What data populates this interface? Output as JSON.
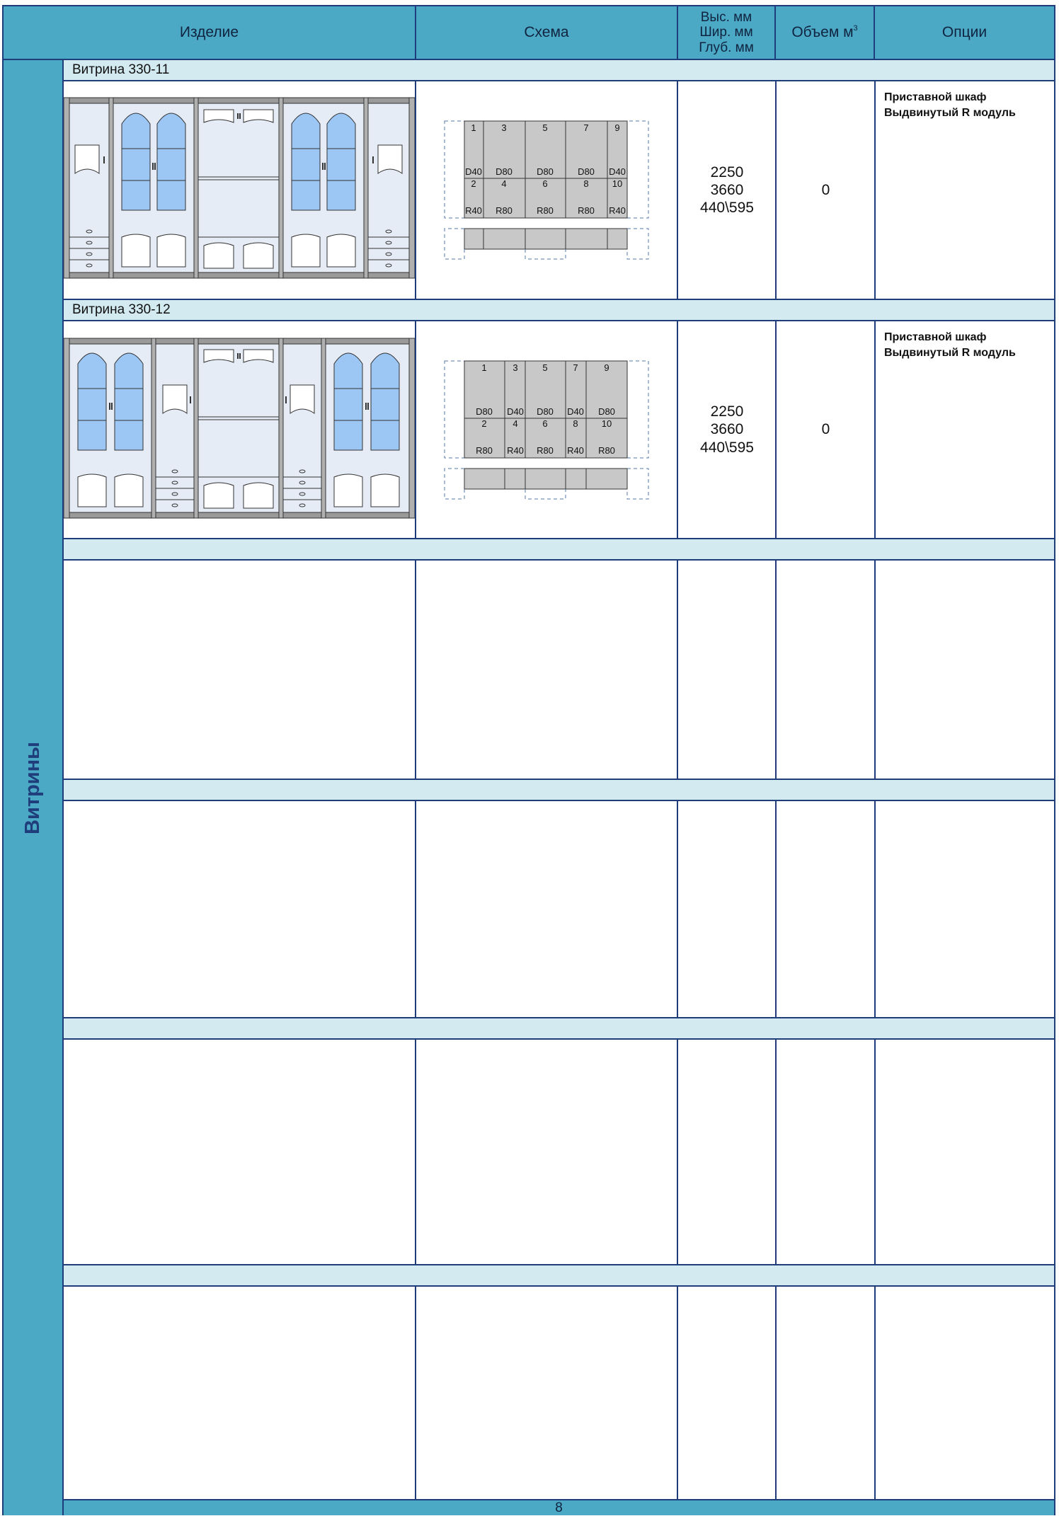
{
  "header": {
    "col_product": "Изделие",
    "col_scheme": "Схема",
    "col_dims": "Выс. мм\nШир. мм\nГлуб. мм",
    "col_volume": "Объем м",
    "col_volume_sup": "3",
    "col_options": "Опции"
  },
  "sidebar": {
    "label": "Витрины"
  },
  "rows": [
    {
      "title": "Витрина 330-11",
      "dims": "2250\n3660\n440\\595",
      "volume": "0",
      "options": "Приставной шкаф\nВыдвинутый R модуль",
      "scheme": {
        "top_numbers": [
          "1",
          "3",
          "5",
          "7",
          "9"
        ],
        "top_types": [
          "D40",
          "D80",
          "D80",
          "D80",
          "D40"
        ],
        "bottom_numbers": [
          "2",
          "4",
          "6",
          "8",
          "10"
        ],
        "bottom_types": [
          "R40",
          "R80",
          "R80",
          "R80",
          "R40"
        ]
      }
    },
    {
      "title": "Витрина 330-12",
      "dims": "2250\n3660\n440\\595",
      "volume": "0",
      "options": "Приставной шкаф\nВыдвинутый R модуль",
      "scheme": {
        "top_numbers": [
          "1",
          "3",
          "5",
          "7",
          "9"
        ],
        "top_types": [
          "D80",
          "D40",
          "D80",
          "D40",
          "D80"
        ],
        "bottom_numbers": [
          "2",
          "4",
          "6",
          "8",
          "10"
        ],
        "bottom_types": [
          "R80",
          "R40",
          "R80",
          "R40",
          "R80"
        ]
      }
    },
    {
      "title": "",
      "dims": "",
      "volume": "",
      "options": ""
    },
    {
      "title": "",
      "dims": "",
      "volume": "",
      "options": ""
    },
    {
      "title": "",
      "dims": "",
      "volume": "",
      "options": ""
    },
    {
      "title": "",
      "dims": "",
      "volume": "",
      "options": ""
    }
  ],
  "footer": {
    "page": "8"
  }
}
